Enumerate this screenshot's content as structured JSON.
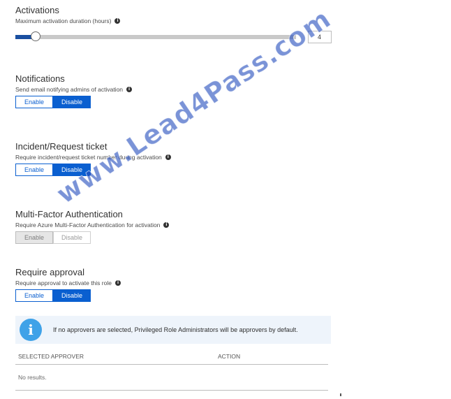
{
  "activations": {
    "title": "Activations",
    "description": "Maximum activation duration (hours)",
    "slider_value_fraction": 0.05,
    "duration_value": "4"
  },
  "notifications": {
    "title": "Notifications",
    "description": "Send email notifying admins of activation",
    "enable_label": "Enable",
    "disable_label": "Disable",
    "selected": "Disable"
  },
  "incident_ticket": {
    "title": "Incident/Request ticket",
    "description": "Require incident/request ticket number during activation",
    "enable_label": "Enable",
    "disable_label": "Disable",
    "selected": "Disable"
  },
  "mfa": {
    "title": "Multi-Factor Authentication",
    "description": "Require Azure Multi-Factor Authentication for activation",
    "enable_label": "Enable",
    "disable_label": "Disable",
    "selected": "Enable",
    "disabled": true
  },
  "approval": {
    "title": "Require approval",
    "description": "Require approval to activate this role",
    "enable_label": "Enable",
    "disable_label": "Disable",
    "selected": "Disable"
  },
  "info_message": "If no approvers are selected, Privileged Role Administrators will be approvers by default.",
  "approvers_table": {
    "columns": [
      "SELECTED APPROVER",
      "ACTION"
    ],
    "empty_text": "No results."
  },
  "watermark": "www.Lead4Pass.com",
  "colors": {
    "accent": "#0a5fd0",
    "slider_fill": "#1a4fa0",
    "info_icon": "#3fa2e8",
    "info_bg": "#eef4fb"
  },
  "icons": {
    "description_info": "info-icon",
    "message_info": "info-circle-icon"
  }
}
